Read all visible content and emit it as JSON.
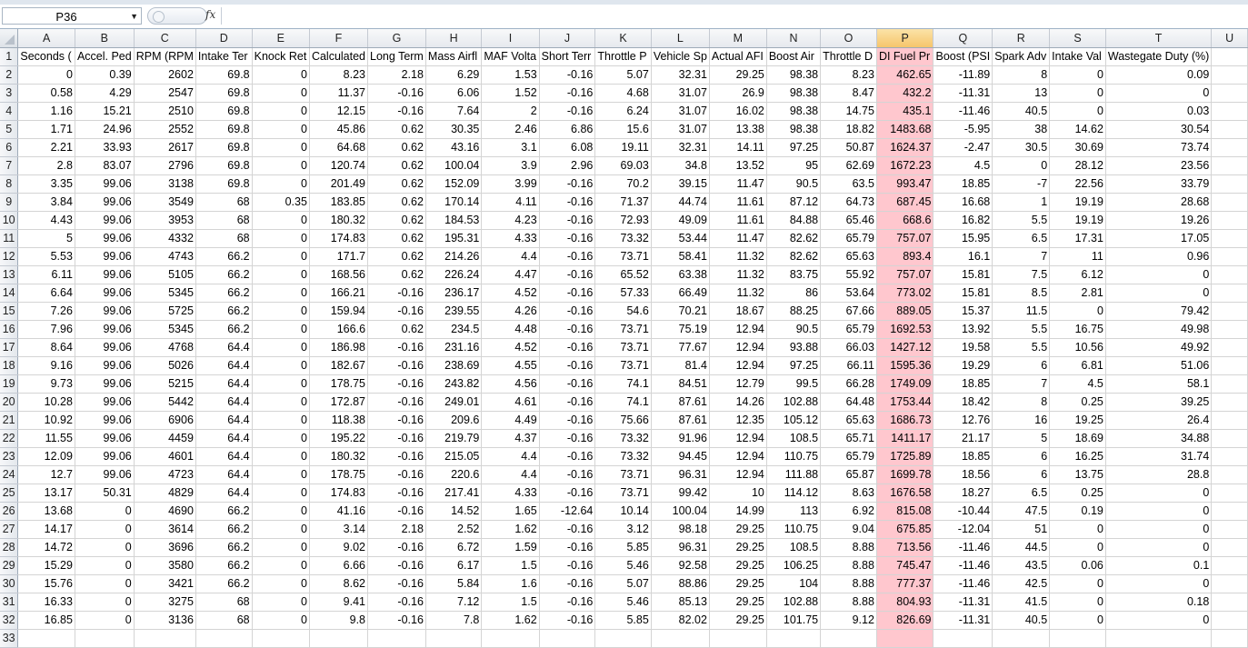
{
  "formula_bar": {
    "name_box": "P36",
    "fx_label": "fx",
    "formula": ""
  },
  "columns": [
    "A",
    "B",
    "C",
    "D",
    "E",
    "F",
    "G",
    "H",
    "I",
    "J",
    "K",
    "L",
    "M",
    "N",
    "O",
    "P",
    "Q",
    "R",
    "S",
    "T",
    "U"
  ],
  "selected_column": "P",
  "highlight_color": "#ffc7ce",
  "headers": [
    "Seconds (",
    "Accel. Ped",
    "RPM (RPM",
    "Intake Ter",
    "Knock Ret",
    "Calculated",
    "Long Term",
    "Mass Airfl",
    "MAF Volta",
    "Short Terr",
    "Throttle P",
    "Vehicle Sp",
    "Actual AFI",
    "Boost Air",
    "Throttle D",
    "DI Fuel Pr",
    "Boost (PSI",
    "Spark Adv",
    "Intake Val",
    "Wastegate Duty (%)",
    ""
  ],
  "rows": [
    [
      "0",
      "0.39",
      "2602",
      "69.8",
      "0",
      "8.23",
      "2.18",
      "6.29",
      "1.53",
      "-0.16",
      "5.07",
      "32.31",
      "29.25",
      "98.38",
      "8.23",
      "462.65",
      "-11.89",
      "8",
      "0",
      "0.09"
    ],
    [
      "0.58",
      "4.29",
      "2547",
      "69.8",
      "0",
      "11.37",
      "-0.16",
      "6.06",
      "1.52",
      "-0.16",
      "4.68",
      "31.07",
      "26.9",
      "98.38",
      "8.47",
      "432.2",
      "-11.31",
      "13",
      "0",
      "0"
    ],
    [
      "1.16",
      "15.21",
      "2510",
      "69.8",
      "0",
      "12.15",
      "-0.16",
      "7.64",
      "2",
      "-0.16",
      "6.24",
      "31.07",
      "16.02",
      "98.38",
      "14.75",
      "435.1",
      "-11.46",
      "40.5",
      "0",
      "0.03"
    ],
    [
      "1.71",
      "24.96",
      "2552",
      "69.8",
      "0",
      "45.86",
      "0.62",
      "30.35",
      "2.46",
      "6.86",
      "15.6",
      "31.07",
      "13.38",
      "98.38",
      "18.82",
      "1483.68",
      "-5.95",
      "38",
      "14.62",
      "30.54"
    ],
    [
      "2.21",
      "33.93",
      "2617",
      "69.8",
      "0",
      "64.68",
      "0.62",
      "43.16",
      "3.1",
      "6.08",
      "19.11",
      "32.31",
      "14.11",
      "97.25",
      "50.87",
      "1624.37",
      "-2.47",
      "30.5",
      "30.69",
      "73.74"
    ],
    [
      "2.8",
      "83.07",
      "2796",
      "69.8",
      "0",
      "120.74",
      "0.62",
      "100.04",
      "3.9",
      "2.96",
      "69.03",
      "34.8",
      "13.52",
      "95",
      "62.69",
      "1672.23",
      "4.5",
      "0",
      "28.12",
      "23.56"
    ],
    [
      "3.35",
      "99.06",
      "3138",
      "69.8",
      "0",
      "201.49",
      "0.62",
      "152.09",
      "3.99",
      "-0.16",
      "70.2",
      "39.15",
      "11.47",
      "90.5",
      "63.5",
      "993.47",
      "18.85",
      "-7",
      "22.56",
      "33.79"
    ],
    [
      "3.84",
      "99.06",
      "3549",
      "68",
      "0.35",
      "183.85",
      "0.62",
      "170.14",
      "4.11",
      "-0.16",
      "71.37",
      "44.74",
      "11.61",
      "87.12",
      "64.73",
      "687.45",
      "16.68",
      "1",
      "19.19",
      "28.68"
    ],
    [
      "4.43",
      "99.06",
      "3953",
      "68",
      "0",
      "180.32",
      "0.62",
      "184.53",
      "4.23",
      "-0.16",
      "72.93",
      "49.09",
      "11.61",
      "84.88",
      "65.46",
      "668.6",
      "16.82",
      "5.5",
      "19.19",
      "19.26"
    ],
    [
      "5",
      "99.06",
      "4332",
      "68",
      "0",
      "174.83",
      "0.62",
      "195.31",
      "4.33",
      "-0.16",
      "73.32",
      "53.44",
      "11.47",
      "82.62",
      "65.79",
      "757.07",
      "15.95",
      "6.5",
      "17.31",
      "17.05"
    ],
    [
      "5.53",
      "99.06",
      "4743",
      "66.2",
      "0",
      "171.7",
      "0.62",
      "214.26",
      "4.4",
      "-0.16",
      "73.71",
      "58.41",
      "11.32",
      "82.62",
      "65.63",
      "893.4",
      "16.1",
      "7",
      "11",
      "0.96"
    ],
    [
      "6.11",
      "99.06",
      "5105",
      "66.2",
      "0",
      "168.56",
      "0.62",
      "226.24",
      "4.47",
      "-0.16",
      "65.52",
      "63.38",
      "11.32",
      "83.75",
      "55.92",
      "757.07",
      "15.81",
      "7.5",
      "6.12",
      "0"
    ],
    [
      "6.64",
      "99.06",
      "5345",
      "66.2",
      "0",
      "166.21",
      "-0.16",
      "236.17",
      "4.52",
      "-0.16",
      "57.33",
      "66.49",
      "11.32",
      "86",
      "53.64",
      "773.02",
      "15.81",
      "8.5",
      "2.81",
      "0"
    ],
    [
      "7.26",
      "99.06",
      "5725",
      "66.2",
      "0",
      "159.94",
      "-0.16",
      "239.55",
      "4.26",
      "-0.16",
      "54.6",
      "70.21",
      "18.67",
      "88.25",
      "67.66",
      "889.05",
      "15.37",
      "11.5",
      "0",
      "79.42"
    ],
    [
      "7.96",
      "99.06",
      "5345",
      "66.2",
      "0",
      "166.6",
      "0.62",
      "234.5",
      "4.48",
      "-0.16",
      "73.71",
      "75.19",
      "12.94",
      "90.5",
      "65.79",
      "1692.53",
      "13.92",
      "5.5",
      "16.75",
      "49.98"
    ],
    [
      "8.64",
      "99.06",
      "4768",
      "64.4",
      "0",
      "186.98",
      "-0.16",
      "231.16",
      "4.52",
      "-0.16",
      "73.71",
      "77.67",
      "12.94",
      "93.88",
      "66.03",
      "1427.12",
      "19.58",
      "5.5",
      "10.56",
      "49.92"
    ],
    [
      "9.16",
      "99.06",
      "5026",
      "64.4",
      "0",
      "182.67",
      "-0.16",
      "238.69",
      "4.55",
      "-0.16",
      "73.71",
      "81.4",
      "12.94",
      "97.25",
      "66.11",
      "1595.36",
      "19.29",
      "6",
      "6.81",
      "51.06"
    ],
    [
      "9.73",
      "99.06",
      "5215",
      "64.4",
      "0",
      "178.75",
      "-0.16",
      "243.82",
      "4.56",
      "-0.16",
      "74.1",
      "84.51",
      "12.79",
      "99.5",
      "66.28",
      "1749.09",
      "18.85",
      "7",
      "4.5",
      "58.1"
    ],
    [
      "10.28",
      "99.06",
      "5442",
      "64.4",
      "0",
      "172.87",
      "-0.16",
      "249.01",
      "4.61",
      "-0.16",
      "74.1",
      "87.61",
      "14.26",
      "102.88",
      "64.48",
      "1753.44",
      "18.42",
      "8",
      "0.25",
      "39.25"
    ],
    [
      "10.92",
      "99.06",
      "6906",
      "64.4",
      "0",
      "118.38",
      "-0.16",
      "209.6",
      "4.49",
      "-0.16",
      "75.66",
      "87.61",
      "12.35",
      "105.12",
      "65.63",
      "1686.73",
      "12.76",
      "16",
      "19.25",
      "26.4"
    ],
    [
      "11.55",
      "99.06",
      "4459",
      "64.4",
      "0",
      "195.22",
      "-0.16",
      "219.79",
      "4.37",
      "-0.16",
      "73.32",
      "91.96",
      "12.94",
      "108.5",
      "65.71",
      "1411.17",
      "21.17",
      "5",
      "18.69",
      "34.88"
    ],
    [
      "12.09",
      "99.06",
      "4601",
      "64.4",
      "0",
      "180.32",
      "-0.16",
      "215.05",
      "4.4",
      "-0.16",
      "73.32",
      "94.45",
      "12.94",
      "110.75",
      "65.79",
      "1725.89",
      "18.85",
      "6",
      "16.25",
      "31.74"
    ],
    [
      "12.7",
      "99.06",
      "4723",
      "64.4",
      "0",
      "178.75",
      "-0.16",
      "220.6",
      "4.4",
      "-0.16",
      "73.71",
      "96.31",
      "12.94",
      "111.88",
      "65.87",
      "1699.78",
      "18.56",
      "6",
      "13.75",
      "28.8"
    ],
    [
      "13.17",
      "50.31",
      "4829",
      "64.4",
      "0",
      "174.83",
      "-0.16",
      "217.41",
      "4.33",
      "-0.16",
      "73.71",
      "99.42",
      "10",
      "114.12",
      "8.63",
      "1676.58",
      "18.27",
      "6.5",
      "0.25",
      "0"
    ],
    [
      "13.68",
      "0",
      "4690",
      "66.2",
      "0",
      "41.16",
      "-0.16",
      "14.52",
      "1.65",
      "-12.64",
      "10.14",
      "100.04",
      "14.99",
      "113",
      "6.92",
      "815.08",
      "-10.44",
      "47.5",
      "0.19",
      "0"
    ],
    [
      "14.17",
      "0",
      "3614",
      "66.2",
      "0",
      "3.14",
      "2.18",
      "2.52",
      "1.62",
      "-0.16",
      "3.12",
      "98.18",
      "29.25",
      "110.75",
      "9.04",
      "675.85",
      "-12.04",
      "51",
      "0",
      "0"
    ],
    [
      "14.72",
      "0",
      "3696",
      "66.2",
      "0",
      "9.02",
      "-0.16",
      "6.72",
      "1.59",
      "-0.16",
      "5.85",
      "96.31",
      "29.25",
      "108.5",
      "8.88",
      "713.56",
      "-11.46",
      "44.5",
      "0",
      "0"
    ],
    [
      "15.29",
      "0",
      "3580",
      "66.2",
      "0",
      "6.66",
      "-0.16",
      "6.17",
      "1.5",
      "-0.16",
      "5.46",
      "92.58",
      "29.25",
      "106.25",
      "8.88",
      "745.47",
      "-11.46",
      "43.5",
      "0.06",
      "0.1"
    ],
    [
      "15.76",
      "0",
      "3421",
      "66.2",
      "0",
      "8.62",
      "-0.16",
      "5.84",
      "1.6",
      "-0.16",
      "5.07",
      "88.86",
      "29.25",
      "104",
      "8.88",
      "777.37",
      "-11.46",
      "42.5",
      "0",
      "0"
    ],
    [
      "16.33",
      "0",
      "3275",
      "68",
      "0",
      "9.41",
      "-0.16",
      "7.12",
      "1.5",
      "-0.16",
      "5.46",
      "85.13",
      "29.25",
      "102.88",
      "8.88",
      "804.93",
      "-11.31",
      "41.5",
      "0",
      "0.18"
    ],
    [
      "16.85",
      "0",
      "3136",
      "68",
      "0",
      "9.8",
      "-0.16",
      "7.8",
      "1.62",
      "-0.16",
      "5.85",
      "82.02",
      "29.25",
      "101.75",
      "9.12",
      "826.69",
      "-11.31",
      "40.5",
      "0",
      "0"
    ]
  ],
  "empty_row_numbers": [
    "33"
  ]
}
